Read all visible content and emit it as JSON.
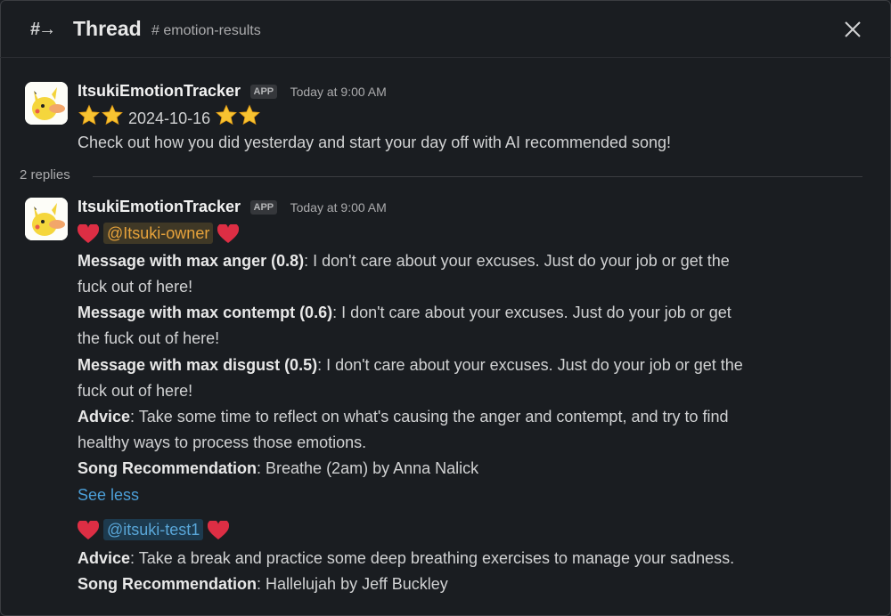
{
  "header": {
    "title": "Thread",
    "channel": "# emotion-results"
  },
  "parent": {
    "author": "ItsukiEmotionTracker",
    "badge": "APP",
    "time": "Today at 9:00 AM",
    "date": "2024-10-16",
    "text": "Check out how you did yesterday and start your day off with AI recommended song!"
  },
  "replies_label": "2 replies",
  "reply": {
    "author": "ItsukiEmotionTracker",
    "badge": "APP",
    "time": "Today at 9:00 AM",
    "mention1": "@Itsuki-owner",
    "max_anger_label": "Message with max anger (0.8)",
    "max_anger_text": ": I don't care about your excuses. Just do your job or get the",
    "max_anger_text2": "fuck out of here!",
    "max_contempt_label": "Message with max contempt (0.6)",
    "max_contempt_text": ": I don't care about your excuses. Just do your job or get",
    "max_contempt_text2": "the fuck out of here!",
    "max_disgust_label": "Message with max disgust (0.5)",
    "max_disgust_text": ": I don't care about your excuses. Just do your job or get the",
    "max_disgust_text2": "fuck out of here!",
    "advice_label": "Advice",
    "advice_text": ": Take some time to reflect on what's causing the anger and contempt, and try to find",
    "advice_text2": "healthy ways to process those emotions.",
    "song_label": "Song Recommendation",
    "song_text": ": Breathe (2am) by Anna Nalick",
    "see_less": "See less",
    "mention2": "@itsuki-test1",
    "advice2_label": "Advice",
    "advice2_text": ": Take a break and practice some deep breathing exercises to manage your sadness.",
    "song2_label": "Song Recommendation",
    "song2_text": ": Hallelujah by Jeff Buckley"
  },
  "icons": {
    "thread": "thread-icon",
    "close": "close-icon",
    "star": "star-emoji",
    "heart": "red-heart-emoji",
    "avatar": "pikachu-avatar"
  },
  "colors": {
    "background": "#1a1d21",
    "mention_owner": "#e8a33b",
    "mention_user": "#59a6d8",
    "link": "#4c9fd8"
  }
}
